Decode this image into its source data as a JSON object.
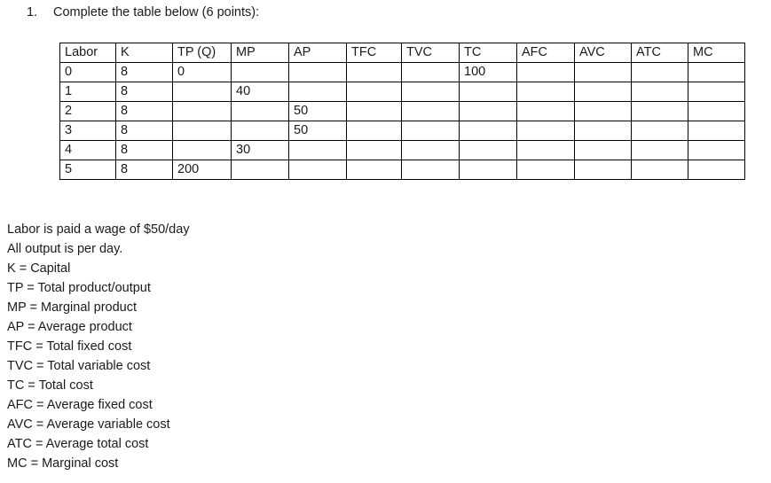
{
  "question": {
    "number": "1.",
    "text": "Complete the table below (6 points):"
  },
  "table": {
    "headers": [
      "Labor",
      "K",
      "TP (Q)",
      "MP",
      "AP",
      "TFC",
      "TVC",
      "TC",
      "AFC",
      "AVC",
      "ATC",
      "MC"
    ],
    "rows": [
      [
        "0",
        "8",
        "0",
        "",
        "",
        "",
        "",
        "100",
        "",
        "",
        "",
        ""
      ],
      [
        "1",
        "8",
        "",
        "40",
        "",
        "",
        "",
        "",
        "",
        "",
        "",
        ""
      ],
      [
        "2",
        "8",
        "",
        "",
        "50",
        "",
        "",
        "",
        "",
        "",
        "",
        ""
      ],
      [
        "3",
        "8",
        "",
        "",
        "50",
        "",
        "",
        "",
        "",
        "",
        "",
        ""
      ],
      [
        "4",
        "8",
        "",
        "30",
        "",
        "",
        "",
        "",
        "",
        "",
        "",
        ""
      ],
      [
        "5",
        "8",
        "200",
        "",
        "",
        "",
        "",
        "",
        "",
        "",
        "",
        ""
      ]
    ]
  },
  "notes": [
    "Labor is paid a wage of $50/day",
    "All output is per day.",
    "K = Capital",
    "TP = Total product/output",
    "MP = Marginal product",
    "AP = Average product",
    "TFC = Total fixed cost",
    "TVC = Total variable cost",
    "TC = Total cost",
    "AFC = Average fixed cost",
    "AVC = Average variable cost",
    "ATC = Average total cost",
    "MC = Marginal cost"
  ]
}
